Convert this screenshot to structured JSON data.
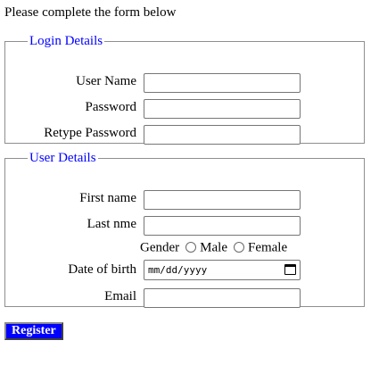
{
  "intro_text": "Please complete the form below",
  "login": {
    "legend": "Login Details",
    "fields": [
      {
        "label": "User Name",
        "value": ""
      },
      {
        "label": "Password",
        "value": ""
      },
      {
        "label": "Retype Password",
        "value": ""
      }
    ]
  },
  "user": {
    "legend": "User Details",
    "first_name": {
      "label": "First name",
      "value": ""
    },
    "last_name": {
      "label": "Last nme",
      "value": ""
    },
    "gender": {
      "label": "Gender",
      "options": [
        "Male",
        "Female"
      ]
    },
    "dob": {
      "label": "Date of birth",
      "placeholder": "mm/dd/yyyy"
    },
    "email": {
      "label": "Email",
      "value": ""
    }
  },
  "register_label": "Register",
  "colors": {
    "legend": "#0000ff",
    "button_bg": "#0000ff",
    "button_text": "#ffffff"
  },
  "icons": {
    "date_picker": "calendar-icon"
  }
}
